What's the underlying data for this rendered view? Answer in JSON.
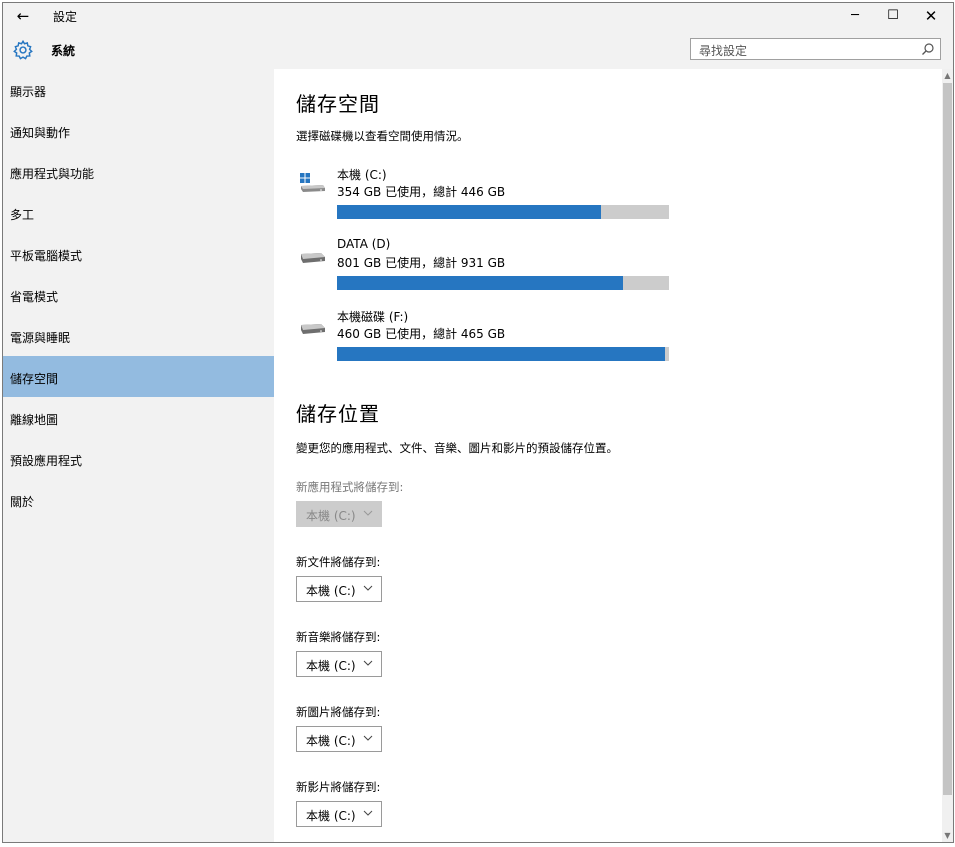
{
  "window": {
    "title": "設定",
    "back_icon": "←",
    "minimize_icon": "─",
    "maximize_icon": "☐",
    "close_icon": "✕"
  },
  "header": {
    "section_title": "系統",
    "search_placeholder": "尋找設定"
  },
  "sidebar": {
    "items": [
      {
        "label": "顯示器"
      },
      {
        "label": "通知與動作"
      },
      {
        "label": "應用程式與功能"
      },
      {
        "label": "多工"
      },
      {
        "label": "平板電腦模式"
      },
      {
        "label": "省電模式"
      },
      {
        "label": "電源與睡眠"
      },
      {
        "label": "儲存空間",
        "active": true
      },
      {
        "label": "離線地圖"
      },
      {
        "label": "預設應用程式"
      },
      {
        "label": "關於"
      }
    ]
  },
  "storage": {
    "title": "儲存空間",
    "description": "選擇磁碟機以查看空間使用情況。",
    "drives": [
      {
        "name": "本機 (C:)",
        "usage": "354 GB 已使用，總計 446 GB",
        "fraction": 0.794,
        "icon": "windows-drive-icon"
      },
      {
        "name": "DATA (D)",
        "usage": "801 GB 已使用，總計 931 GB",
        "fraction": 0.86,
        "icon": "drive-icon"
      },
      {
        "name": "本機磁碟 (F:)",
        "usage": "460 GB 已使用，總計 465 GB",
        "fraction": 0.989,
        "icon": "drive-icon"
      }
    ]
  },
  "locations": {
    "title": "儲存位置",
    "description": "變更您的應用程式、文件、音樂、圖片和影片的預設儲存位置。",
    "items": [
      {
        "label": "新應用程式將儲存到:",
        "value": "本機 (C:)",
        "disabled": true
      },
      {
        "label": "新文件將儲存到:",
        "value": "本機 (C:)",
        "disabled": false
      },
      {
        "label": "新音樂將儲存到:",
        "value": "本機 (C:)",
        "disabled": false
      },
      {
        "label": "新圖片將儲存到:",
        "value": "本機 (C:)",
        "disabled": false
      },
      {
        "label": "新影片將儲存到:",
        "value": "本機 (C:)",
        "disabled": false
      }
    ]
  },
  "colors": {
    "accent": "#2676c1",
    "bar_track": "#cccccc",
    "nav_active": "#93bbe0",
    "chrome_bg": "#f2f2f2"
  }
}
